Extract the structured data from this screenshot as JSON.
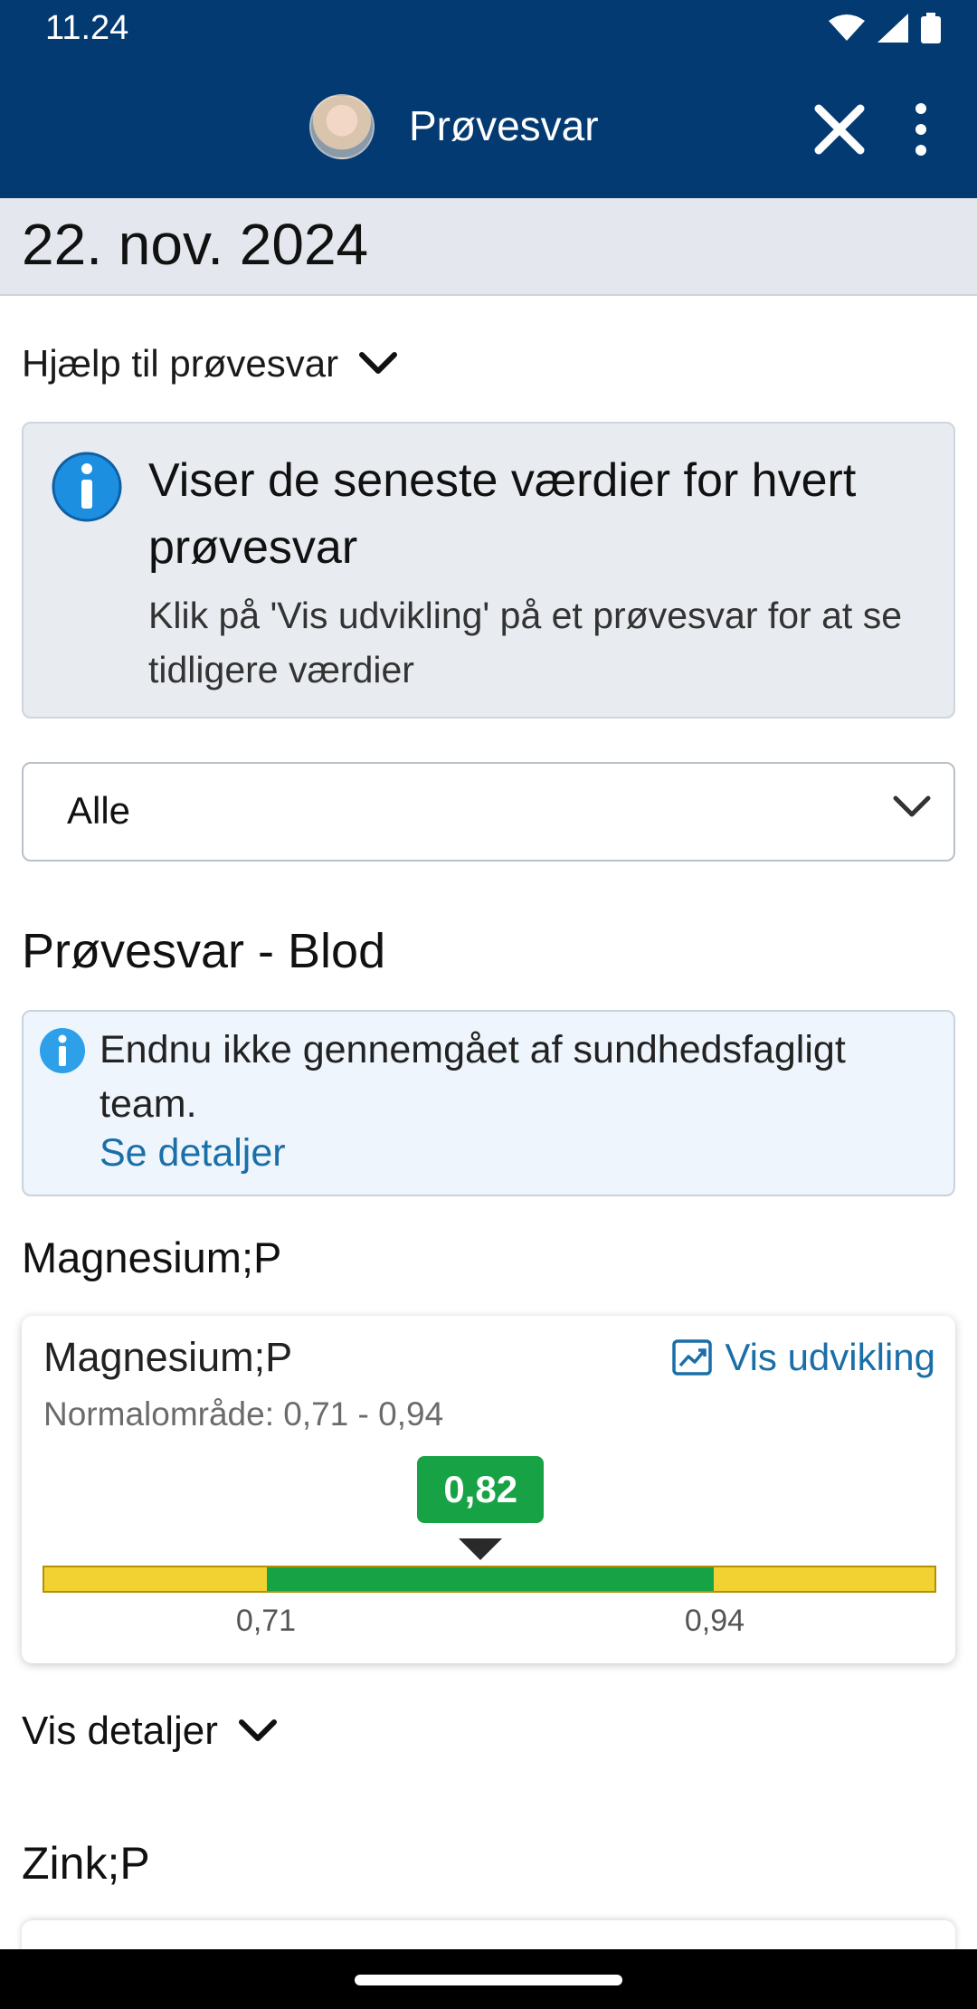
{
  "status_bar": {
    "time": "11.24"
  },
  "app_bar": {
    "title": "Prøvesvar"
  },
  "date_header": "22. nov. 2024",
  "help": {
    "label": "Hjælp til prøvesvar"
  },
  "info_box": {
    "heading": "Viser de seneste værdier for hvert prøvesvar",
    "body": "Klik på 'Vis udvikling' på et prøvesvar for at se tidligere værdier"
  },
  "filter": {
    "selected": "Alle"
  },
  "section": {
    "title": "Prøvesvar - Blod"
  },
  "review_notice": {
    "message": "Endnu ikke gennemgået af sundhedsfagligt team.",
    "link": "Se detaljer"
  },
  "tests": [
    {
      "group_label": "Magnesium;P",
      "name": "Magnesium;P",
      "trend_label": "Vis udvikling",
      "normal_range_text": "Normalområde: 0,71 - 0,94",
      "value_text": "0,82",
      "value": 0.82,
      "range_low": 0.71,
      "range_high": 0.94,
      "low_label": "0,71",
      "high_label": "0,94",
      "details_label": "Vis detaljer"
    }
  ],
  "next_test": {
    "group_label": "Zink;P"
  },
  "colors": {
    "app_bar": "#043a72",
    "in_range": "#17a345",
    "out_of_range": "#f2d232",
    "link": "#1a6fa8",
    "info_icon": "#1d8fe0"
  }
}
